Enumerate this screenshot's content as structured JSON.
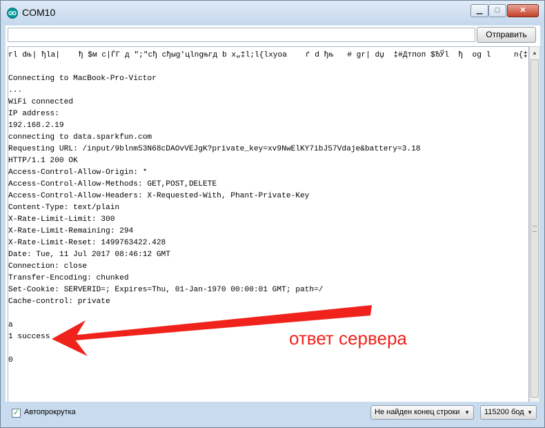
{
  "window": {
    "title": "COM10",
    "controls": {
      "minimize": "▁",
      "maximize": "□",
      "close": "✕"
    }
  },
  "input": {
    "value": "",
    "placeholder": ""
  },
  "send_button": "Отправить",
  "console_lines": [
    "rl dњ| ђla|    ђ $м c|ЃГ д \";\"cђ cђыg'цlngњгд b x„‡l;l{lxyoa    ѓ d ђњ   # gr| dџ  ‡#Дтпоп $ЂЎl  ђ  og l     n{‡\"",
    "",
    "Connecting to MacBook-Pro-Victor",
    "...",
    "WiFi connected",
    "IP address:",
    "192.168.2.19",
    "connecting to data.sparkfun.com",
    "Requesting URL: /input/9blnm53N68cDAOvVEJgK?private_key=xv9NwElKY7ibJ57Vdaje&battery=3.18",
    "HTTP/1.1 200 OK",
    "Access-Control-Allow-Origin: *",
    "Access-Control-Allow-Methods: GET,POST,DELETE",
    "Access-Control-Allow-Headers: X-Requested-With, Phant-Private-Key",
    "Content-Type: text/plain",
    "X-Rate-Limit-Limit: 300",
    "X-Rate-Limit-Remaining: 294",
    "X-Rate-Limit-Reset: 1499763422.428",
    "Date: Tue, 11 Jul 2017 08:46:12 GMT",
    "Connection: close",
    "Transfer-Encoding: chunked",
    "Set-Cookie: SERVERID=; Expires=Thu, 01-Jan-1970 00:00:01 GMT; path=/",
    "Cache-control: private",
    "",
    "a",
    "1 success",
    "",
    "0"
  ],
  "annotation": {
    "text": "ответ сервера",
    "color": "#f0221c"
  },
  "autoscroll": {
    "label": "Автопрокрутка",
    "checked": true,
    "check_glyph": "✓"
  },
  "line_ending": {
    "selected": "Не найден конец строки",
    "arrow": "▼"
  },
  "baud_rate": {
    "selected": "115200 бод",
    "arrow": "▼"
  },
  "scroll_glyphs": {
    "up": "▲",
    "down": "▼",
    "left": "◀",
    "right": "▶"
  },
  "colors": {
    "frame": "#c9dcef",
    "accent_arduino": "#00979c",
    "close_button": "#c4412a"
  }
}
